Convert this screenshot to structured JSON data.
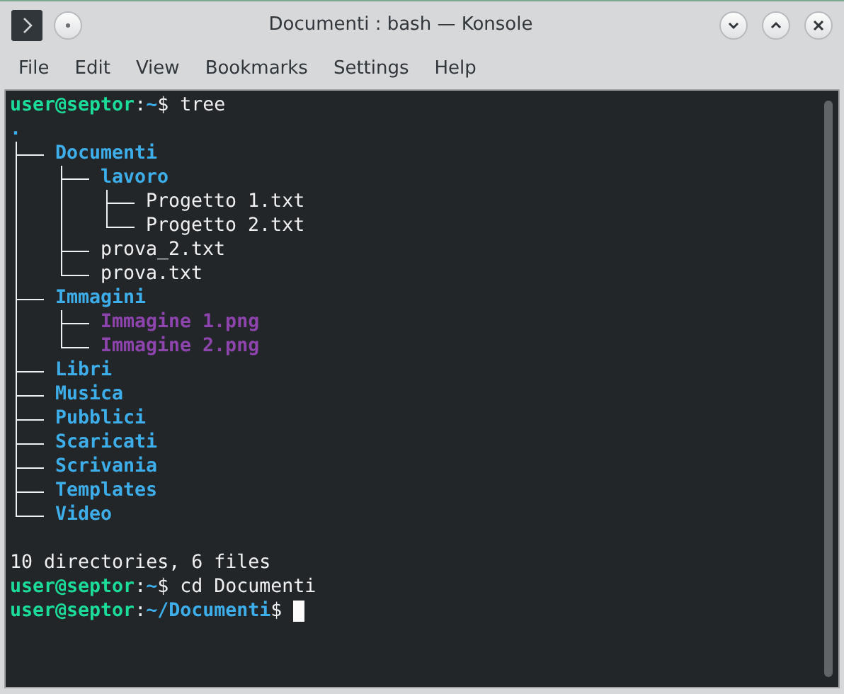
{
  "window": {
    "title": "Documenti : bash — Konsole"
  },
  "menu": [
    "File",
    "Edit",
    "View",
    "Bookmarks",
    "Settings",
    "Help"
  ],
  "terminal": {
    "lines": [
      {
        "kind": "prompt",
        "user_host": "user@septor",
        "separator": ":",
        "path": "~",
        "symbol": "$",
        "command": "tree"
      },
      {
        "kind": "tree",
        "root": ".",
        "children": [
          {
            "name": "Documenti",
            "kind": "dir",
            "children": [
              {
                "name": "lavoro",
                "kind": "dir",
                "children": [
                  {
                    "name": "Progetto 1.txt",
                    "kind": "file"
                  },
                  {
                    "name": "Progetto 2.txt",
                    "kind": "file"
                  }
                ]
              },
              {
                "name": "prova_2.txt",
                "kind": "file"
              },
              {
                "name": "prova.txt",
                "kind": "file"
              }
            ]
          },
          {
            "name": "Immagini",
            "kind": "dir",
            "children": [
              {
                "name": "Immagine 1.png",
                "kind": "image"
              },
              {
                "name": "Immagine 2.png",
                "kind": "image"
              }
            ]
          },
          {
            "name": "Libri",
            "kind": "dir"
          },
          {
            "name": "Musica",
            "kind": "dir"
          },
          {
            "name": "Pubblici",
            "kind": "dir"
          },
          {
            "name": "Scaricati",
            "kind": "dir"
          },
          {
            "name": "Scrivania",
            "kind": "dir"
          },
          {
            "name": "Templates",
            "kind": "dir"
          },
          {
            "name": "Video",
            "kind": "dir"
          }
        ]
      },
      {
        "kind": "blank"
      },
      {
        "kind": "text",
        "text": "10 directories, 6 files"
      },
      {
        "kind": "prompt",
        "user_host": "user@septor",
        "separator": ":",
        "path": "~",
        "symbol": "$",
        "command": "cd Documenti"
      },
      {
        "kind": "prompt",
        "user_host": "user@septor",
        "separator": ":",
        "path": "~/Documenti",
        "symbol": "$",
        "cursor": true
      }
    ]
  }
}
